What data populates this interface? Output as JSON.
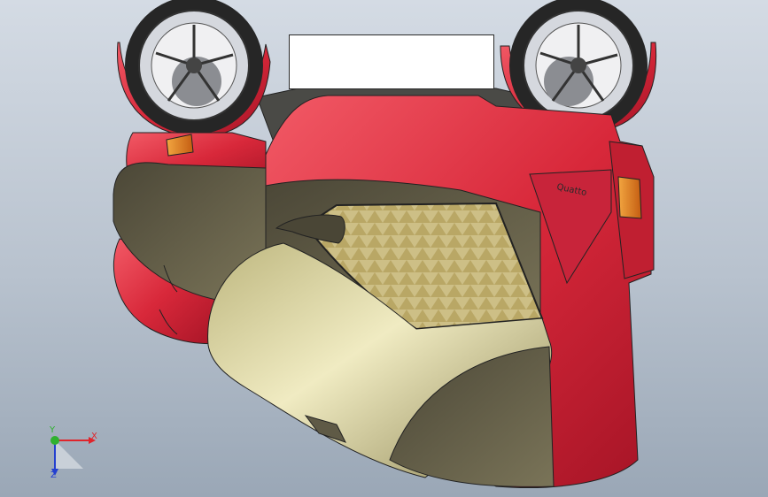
{
  "viewport": {
    "background_top": "#d4dbe4",
    "background_bottom": "#9aa7b6"
  },
  "model": {
    "body_color": "#d8283a",
    "canopy_color": "#d9d29a",
    "dark_panel_color": "#5f5a46",
    "rim_color": "#c9ccd2",
    "tire_color": "#2a2a2a",
    "badge_text": "Quatto"
  },
  "triad": {
    "x_label": "X",
    "y_label": "Y",
    "z_label": "Z",
    "x_color": "#e0242b",
    "y_color": "#2fb12f",
    "z_color": "#2440d0"
  }
}
